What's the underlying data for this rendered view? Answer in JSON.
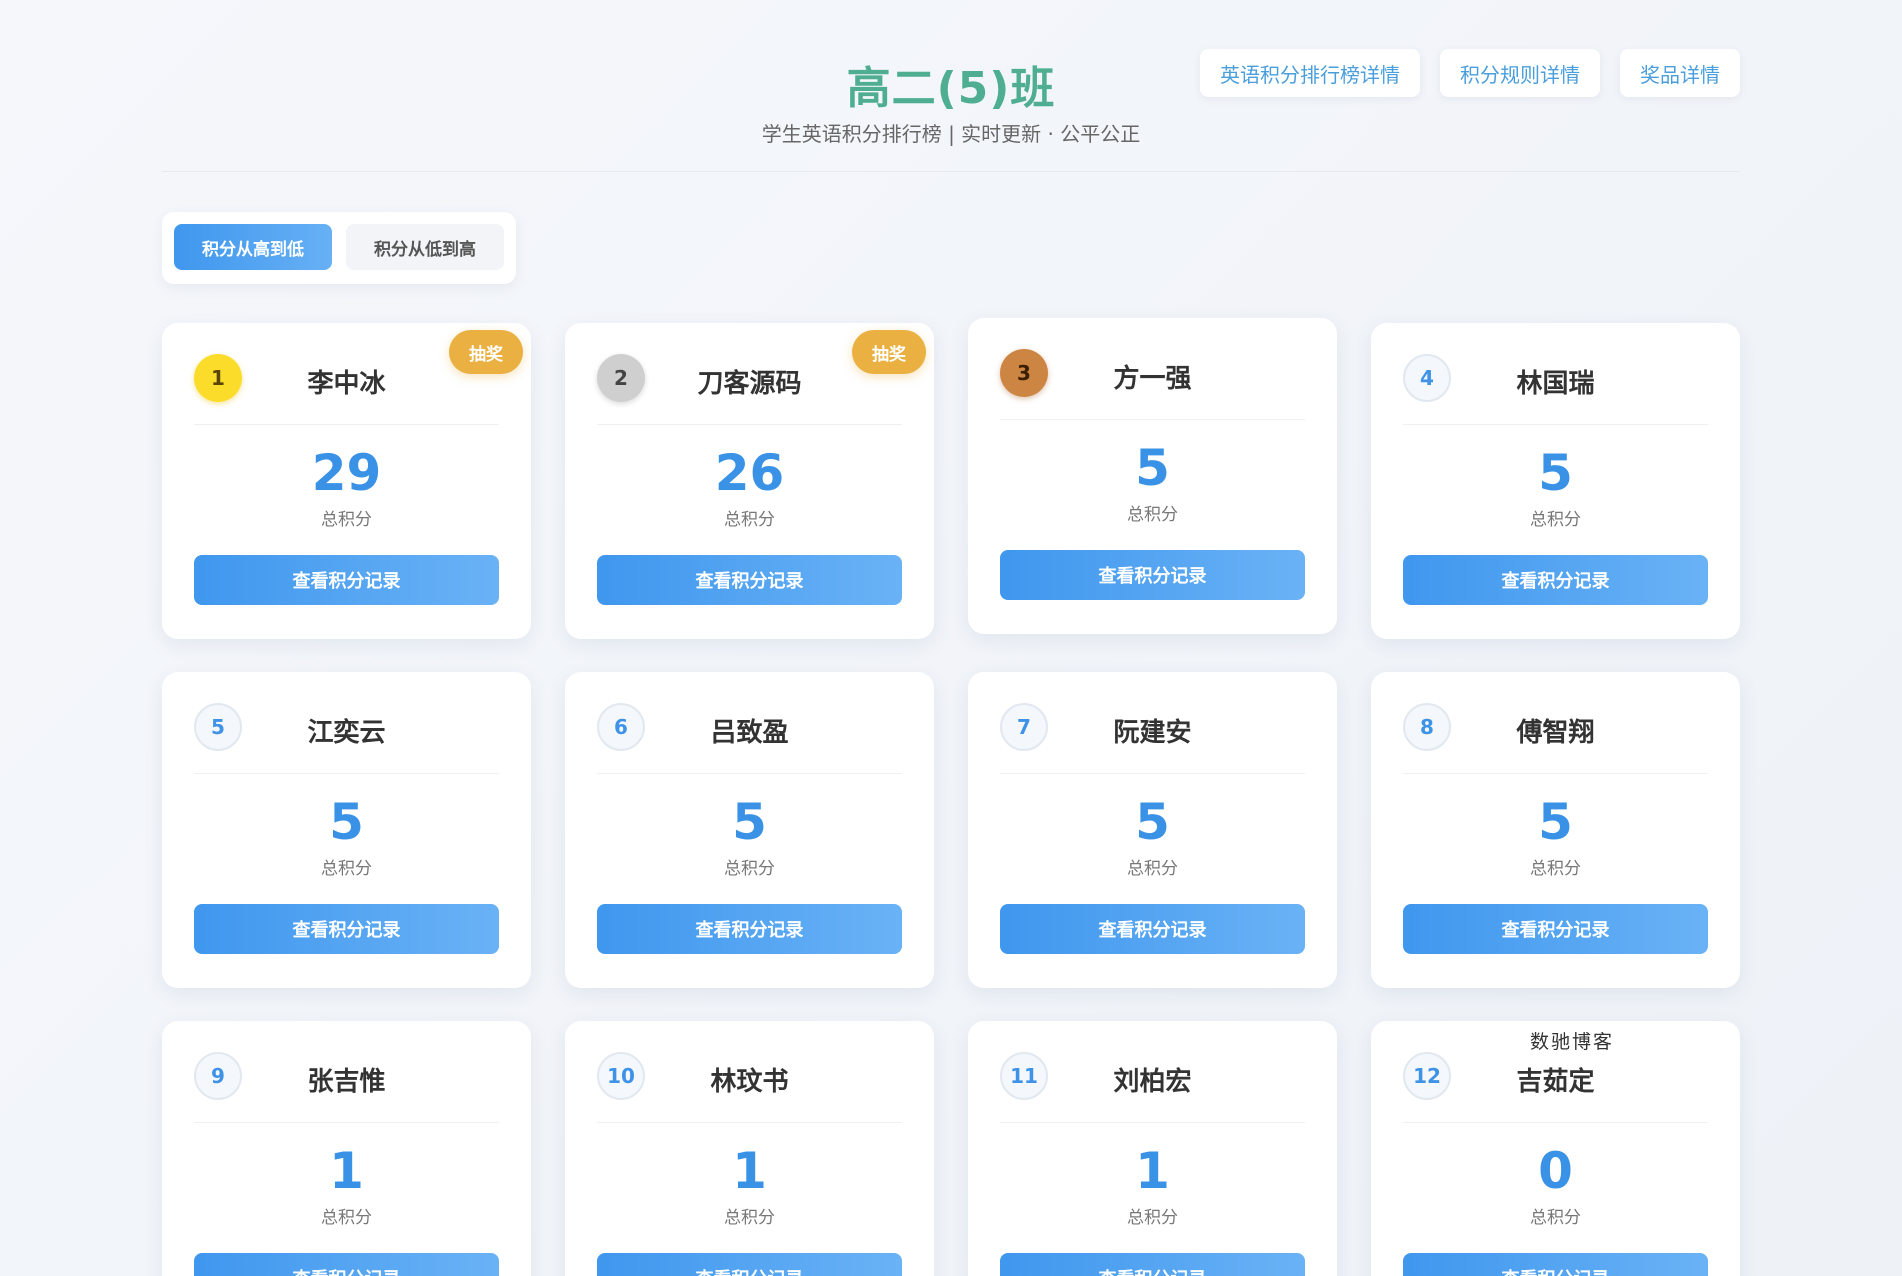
{
  "header": {
    "title": "高二(5)班",
    "subtitle": "学生英语积分排行榜 | 实时更新 · 公平公正",
    "links": [
      "英语积分排行榜详情",
      "积分规则详情",
      "奖品详情"
    ]
  },
  "sort": {
    "options": [
      "积分从高到低",
      "积分从低到高"
    ],
    "active_index": 0
  },
  "card_labels": {
    "score_label": "总积分",
    "record_button": "查看积分记录",
    "lottery_badge": "抽奖"
  },
  "students": [
    {
      "rank": "1",
      "name": "李中冰",
      "score": "29",
      "lottery": true,
      "medal": "gold"
    },
    {
      "rank": "2",
      "name": "刀客源码",
      "score": "26",
      "lottery": true,
      "medal": "silver"
    },
    {
      "rank": "3",
      "name": "方一强",
      "score": "5",
      "lottery": false,
      "medal": "bronze"
    },
    {
      "rank": "4",
      "name": "林国瑞",
      "score": "5",
      "lottery": false,
      "medal": "normal"
    },
    {
      "rank": "5",
      "name": "江奕云",
      "score": "5",
      "lottery": false,
      "medal": "normal"
    },
    {
      "rank": "6",
      "name": "吕致盈",
      "score": "5",
      "lottery": false,
      "medal": "normal"
    },
    {
      "rank": "7",
      "name": "阮建安",
      "score": "5",
      "lottery": false,
      "medal": "normal"
    },
    {
      "rank": "8",
      "name": "傅智翔",
      "score": "5",
      "lottery": false,
      "medal": "normal"
    },
    {
      "rank": "9",
      "name": "张吉惟",
      "score": "1",
      "lottery": false,
      "medal": "normal"
    },
    {
      "rank": "10",
      "name": "林玟书",
      "score": "1",
      "lottery": false,
      "medal": "normal"
    },
    {
      "rank": "11",
      "name": "刘柏宏",
      "score": "1",
      "lottery": false,
      "medal": "normal"
    },
    {
      "rank": "12",
      "name": "吉茹定",
      "score": "0",
      "lottery": false,
      "medal": "normal"
    }
  ],
  "watermark": "数驰博客",
  "colors": {
    "title": "#4fae92",
    "accent_blue": "#3a92e6",
    "lottery": "#eab041",
    "gold": "#fbdc2a",
    "silver": "#cfcfcf",
    "bronze": "#cd8543"
  }
}
